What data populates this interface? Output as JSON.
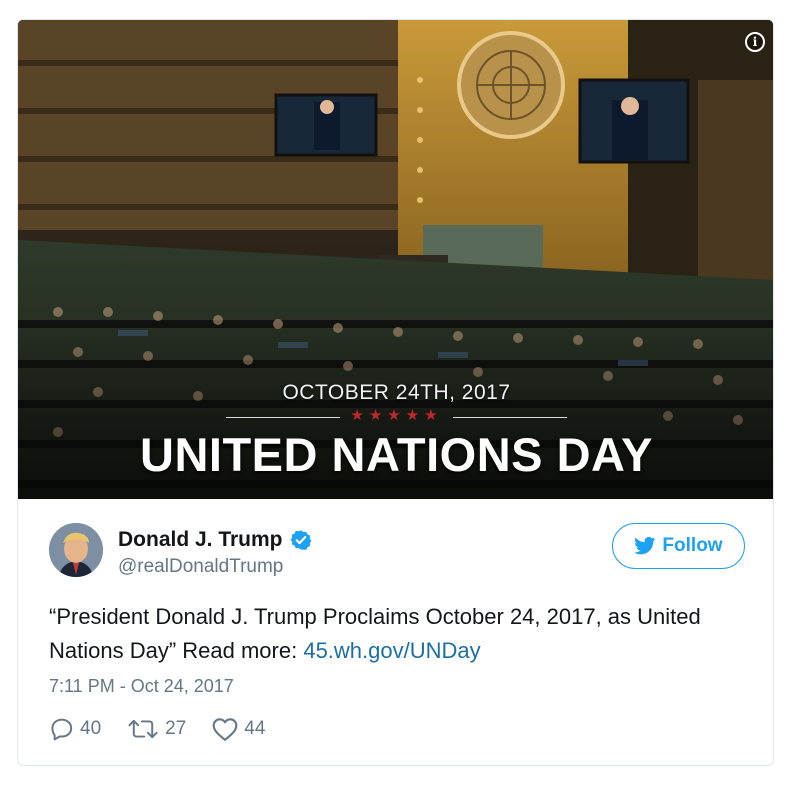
{
  "media": {
    "overlay_date": "OCTOBER 24TH, 2017",
    "overlay_stars": "★★★★★",
    "overlay_title": "UNITED NATIONS DAY"
  },
  "author": {
    "name": "Donald J. Trump",
    "handle": "@realDonaldTrump",
    "verified": true
  },
  "follow": {
    "label": "Follow"
  },
  "tweet": {
    "text_before_link": "“President Donald J. Trump Proclaims October 24, 2017, as United Nations Day” Read more: ",
    "link_text": "45.wh.gov/UNDay"
  },
  "timestamp": "7:11 PM - Oct 24, 2017",
  "actions": {
    "replies": "40",
    "retweets": "27",
    "likes": "44"
  },
  "colors": {
    "twitter_blue": "#1da1f2",
    "link": "#1b6fa8",
    "secondary_text": "#657786",
    "star_red": "#c0282d"
  },
  "icons": [
    "info-icon",
    "verified-icon",
    "twitter-bird-icon",
    "reply-icon",
    "retweet-icon",
    "like-icon"
  ]
}
